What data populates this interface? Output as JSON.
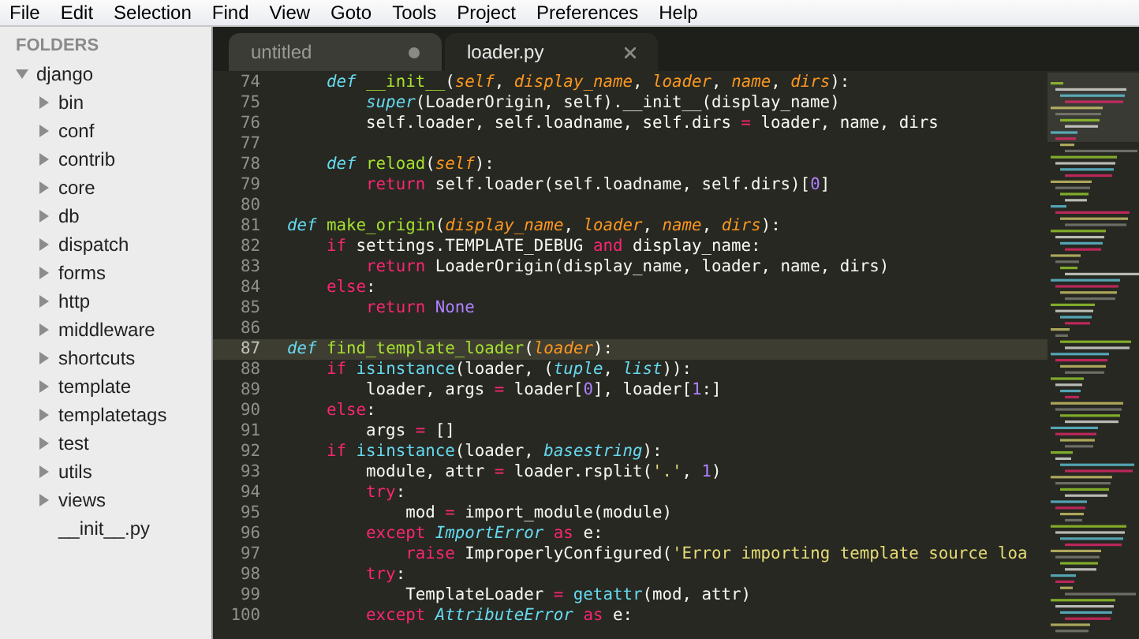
{
  "menu": [
    "File",
    "Edit",
    "Selection",
    "Find",
    "View",
    "Goto",
    "Tools",
    "Project",
    "Preferences",
    "Help"
  ],
  "sidebar": {
    "header": "FOLDERS",
    "tree": [
      {
        "label": "django",
        "kind": "folder",
        "expanded": true,
        "children": [
          {
            "label": "bin",
            "kind": "folder",
            "expanded": false
          },
          {
            "label": "conf",
            "kind": "folder",
            "expanded": false
          },
          {
            "label": "contrib",
            "kind": "folder",
            "expanded": false
          },
          {
            "label": "core",
            "kind": "folder",
            "expanded": false
          },
          {
            "label": "db",
            "kind": "folder",
            "expanded": false
          },
          {
            "label": "dispatch",
            "kind": "folder",
            "expanded": false
          },
          {
            "label": "forms",
            "kind": "folder",
            "expanded": false
          },
          {
            "label": "http",
            "kind": "folder",
            "expanded": false
          },
          {
            "label": "middleware",
            "kind": "folder",
            "expanded": false
          },
          {
            "label": "shortcuts",
            "kind": "folder",
            "expanded": false
          },
          {
            "label": "template",
            "kind": "folder",
            "expanded": false
          },
          {
            "label": "templatetags",
            "kind": "folder",
            "expanded": false
          },
          {
            "label": "test",
            "kind": "folder",
            "expanded": false
          },
          {
            "label": "utils",
            "kind": "folder",
            "expanded": false
          },
          {
            "label": "views",
            "kind": "folder",
            "expanded": false
          },
          {
            "label": "__init__.py",
            "kind": "file"
          }
        ]
      }
    ]
  },
  "tabs": [
    {
      "label": "untitled",
      "selected": false,
      "modified": true
    },
    {
      "label": "loader.py",
      "selected": true,
      "modified": false
    }
  ],
  "editor": {
    "lines": [
      {
        "number": "74",
        "current": false,
        "tokens": [
          {
            "kind": "d",
            "text": "    def "
          },
          {
            "kind": "f",
            "text": "__init__"
          },
          {
            "kind": "p",
            "text": "("
          },
          {
            "kind": "a",
            "text": "self"
          },
          {
            "kind": "p",
            "text": ", "
          },
          {
            "kind": "a",
            "text": "display_name"
          },
          {
            "kind": "p",
            "text": ", "
          },
          {
            "kind": "a",
            "text": "loader"
          },
          {
            "kind": "p",
            "text": ", "
          },
          {
            "kind": "a",
            "text": "name"
          },
          {
            "kind": "p",
            "text": ", "
          },
          {
            "kind": "a",
            "text": "dirs"
          },
          {
            "kind": "p",
            "text": "):"
          }
        ]
      },
      {
        "number": "75",
        "current": false,
        "tokens": [
          {
            "kind": "b",
            "text": "        super"
          },
          {
            "kind": "p",
            "text": "(LoaderOrigin, self).__init__(display_name)"
          }
        ]
      },
      {
        "number": "76",
        "current": false,
        "tokens": [
          {
            "kind": "p",
            "text": "        self.loader, self.loadname, self.dirs "
          },
          {
            "kind": "k",
            "text": "="
          },
          {
            "kind": "p",
            "text": " loader, name, dirs"
          }
        ]
      },
      {
        "number": "77",
        "current": false
      },
      {
        "number": "78",
        "current": false,
        "tokens": [
          {
            "kind": "d",
            "text": "    def "
          },
          {
            "kind": "f",
            "text": "reload"
          },
          {
            "kind": "p",
            "text": "("
          },
          {
            "kind": "a",
            "text": "self"
          },
          {
            "kind": "p",
            "text": "):"
          }
        ]
      },
      {
        "number": "79",
        "current": false,
        "tokens": [
          {
            "kind": "k",
            "text": "        return"
          },
          {
            "kind": "p",
            "text": " self.loader(self.loadname, self.dirs)["
          },
          {
            "kind": "c",
            "text": "0"
          },
          {
            "kind": "p",
            "text": "]"
          }
        ]
      },
      {
        "number": "80",
        "current": false
      },
      {
        "number": "81",
        "current": false,
        "tokens": [
          {
            "kind": "d",
            "text": "def "
          },
          {
            "kind": "f",
            "text": "make_origin"
          },
          {
            "kind": "p",
            "text": "("
          },
          {
            "kind": "a",
            "text": "display_name"
          },
          {
            "kind": "p",
            "text": ", "
          },
          {
            "kind": "a",
            "text": "loader"
          },
          {
            "kind": "p",
            "text": ", "
          },
          {
            "kind": "a",
            "text": "name"
          },
          {
            "kind": "p",
            "text": ", "
          },
          {
            "kind": "a",
            "text": "dirs"
          },
          {
            "kind": "p",
            "text": "):"
          }
        ]
      },
      {
        "number": "82",
        "current": false,
        "tokens": [
          {
            "kind": "k",
            "text": "    if"
          },
          {
            "kind": "p",
            "text": " settings.TEMPLATE_DEBUG "
          },
          {
            "kind": "k",
            "text": "and"
          },
          {
            "kind": "p",
            "text": " display_name:"
          }
        ]
      },
      {
        "number": "83",
        "current": false,
        "tokens": [
          {
            "kind": "k",
            "text": "        return"
          },
          {
            "kind": "p",
            "text": " LoaderOrigin(display_name, loader, name, dirs)"
          }
        ]
      },
      {
        "number": "84",
        "current": false,
        "tokens": [
          {
            "kind": "k",
            "text": "    else"
          },
          {
            "kind": "p",
            "text": ":"
          }
        ]
      },
      {
        "number": "85",
        "current": false,
        "tokens": [
          {
            "kind": "k",
            "text": "        return "
          },
          {
            "kind": "c",
            "text": "None"
          }
        ]
      },
      {
        "number": "86",
        "current": false
      },
      {
        "number": "87",
        "current": true,
        "tokens": [
          {
            "kind": "d",
            "text": "def "
          },
          {
            "kind": "f",
            "text": "find_template_loader"
          },
          {
            "kind": "p",
            "text": "("
          },
          {
            "kind": "a",
            "text": "loader"
          },
          {
            "kind": "p",
            "text": "):"
          }
        ]
      },
      {
        "number": "88",
        "current": false,
        "tokens": [
          {
            "kind": "k",
            "text": "    if "
          },
          {
            "kind": "n",
            "text": "isinstance"
          },
          {
            "kind": "p",
            "text": "(loader, ("
          },
          {
            "kind": "b",
            "text": "tuple"
          },
          {
            "kind": "p",
            "text": ", "
          },
          {
            "kind": "b",
            "text": "list"
          },
          {
            "kind": "p",
            "text": ")):"
          }
        ]
      },
      {
        "number": "89",
        "current": false,
        "tokens": [
          {
            "kind": "p",
            "text": "        loader, args "
          },
          {
            "kind": "k",
            "text": "="
          },
          {
            "kind": "p",
            "text": " loader["
          },
          {
            "kind": "c",
            "text": "0"
          },
          {
            "kind": "p",
            "text": "], loader["
          },
          {
            "kind": "c",
            "text": "1"
          },
          {
            "kind": "p",
            "text": ":]"
          }
        ]
      },
      {
        "number": "90",
        "current": false,
        "tokens": [
          {
            "kind": "k",
            "text": "    else"
          },
          {
            "kind": "p",
            "text": ":"
          }
        ]
      },
      {
        "number": "91",
        "current": false,
        "tokens": [
          {
            "kind": "p",
            "text": "        args "
          },
          {
            "kind": "k",
            "text": "="
          },
          {
            "kind": "p",
            "text": " []"
          }
        ]
      },
      {
        "number": "92",
        "current": false,
        "tokens": [
          {
            "kind": "k",
            "text": "    if "
          },
          {
            "kind": "n",
            "text": "isinstance"
          },
          {
            "kind": "p",
            "text": "(loader, "
          },
          {
            "kind": "b",
            "text": "basestring"
          },
          {
            "kind": "p",
            "text": "):"
          }
        ]
      },
      {
        "number": "93",
        "current": false,
        "tokens": [
          {
            "kind": "p",
            "text": "        module, attr "
          },
          {
            "kind": "k",
            "text": "="
          },
          {
            "kind": "p",
            "text": " loader.rsplit("
          },
          {
            "kind": "s",
            "text": "'.'"
          },
          {
            "kind": "p",
            "text": ", "
          },
          {
            "kind": "c",
            "text": "1"
          },
          {
            "kind": "p",
            "text": ")"
          }
        ]
      },
      {
        "number": "94",
        "current": false,
        "tokens": [
          {
            "kind": "k",
            "text": "        try"
          },
          {
            "kind": "p",
            "text": ":"
          }
        ]
      },
      {
        "number": "95",
        "current": false,
        "tokens": [
          {
            "kind": "p",
            "text": "            mod "
          },
          {
            "kind": "k",
            "text": "="
          },
          {
            "kind": "p",
            "text": " import_module(module)"
          }
        ]
      },
      {
        "number": "96",
        "current": false,
        "tokens": [
          {
            "kind": "k",
            "text": "        except "
          },
          {
            "kind": "b",
            "text": "ImportError"
          },
          {
            "kind": "k",
            "text": " as"
          },
          {
            "kind": "p",
            "text": " e:"
          }
        ]
      },
      {
        "number": "97",
        "current": false,
        "tokens": [
          {
            "kind": "k",
            "text": "            raise"
          },
          {
            "kind": "p",
            "text": " ImproperlyConfigured("
          },
          {
            "kind": "s",
            "text": "'Error importing template source loa"
          }
        ]
      },
      {
        "number": "98",
        "current": false,
        "tokens": [
          {
            "kind": "k",
            "text": "        try"
          },
          {
            "kind": "p",
            "text": ":"
          }
        ]
      },
      {
        "number": "99",
        "current": false,
        "tokens": [
          {
            "kind": "p",
            "text": "            TemplateLoader "
          },
          {
            "kind": "k",
            "text": "= "
          },
          {
            "kind": "n",
            "text": "getattr"
          },
          {
            "kind": "p",
            "text": "(mod, attr)"
          }
        ]
      },
      {
        "number": "100",
        "current": false,
        "tokens": [
          {
            "kind": "k",
            "text": "        except "
          },
          {
            "kind": "b",
            "text": "AttributeError"
          },
          {
            "kind": "k",
            "text": " as"
          },
          {
            "kind": "p",
            "text": " e:"
          }
        ]
      }
    ]
  }
}
